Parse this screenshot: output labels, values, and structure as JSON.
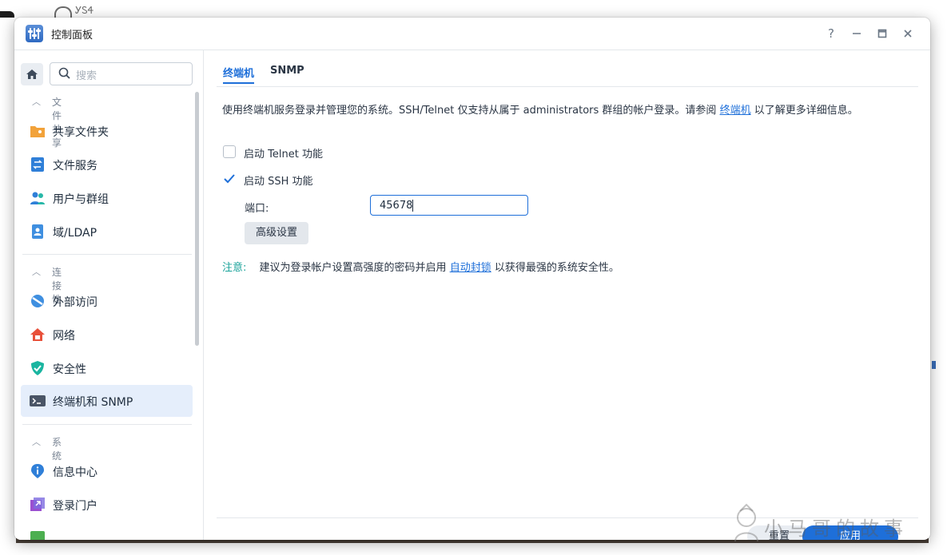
{
  "background": {
    "partial_title": "ᎩᏚᏎ"
  },
  "window": {
    "title": "控制面板",
    "help_glyph": "?",
    "minimize_glyph": "—",
    "maximize_glyph": "□",
    "close_glyph": "✕"
  },
  "sidebar": {
    "search_placeholder": "搜索",
    "sections": [
      {
        "label": "文件共享",
        "items": [
          {
            "label": "共享文件夹",
            "icon": "shared-folder-icon"
          },
          {
            "label": "文件服务",
            "icon": "file-services-icon"
          },
          {
            "label": "用户与群组",
            "icon": "users-groups-icon"
          },
          {
            "label": "域/LDAP",
            "icon": "domain-ldap-icon"
          }
        ]
      },
      {
        "label": "连接性",
        "items": [
          {
            "label": "外部访问",
            "icon": "external-access-icon"
          },
          {
            "label": "网络",
            "icon": "network-icon"
          },
          {
            "label": "安全性",
            "icon": "security-shield-icon"
          },
          {
            "label": "终端机和 SNMP",
            "icon": "terminal-icon",
            "active": true
          }
        ]
      },
      {
        "label": "系统",
        "items": [
          {
            "label": "信息中心",
            "icon": "info-center-icon"
          },
          {
            "label": "登录门户",
            "icon": "login-portal-icon"
          }
        ]
      }
    ]
  },
  "main": {
    "tabs": [
      {
        "label": "终端机",
        "active": true
      },
      {
        "label": "SNMP",
        "active": false
      }
    ],
    "description_prefix": "使用终端机服务登录并管理您的系统。SSH/Telnet 仅支持从属于 administrators 群组的帐户登录。请参阅",
    "description_link": "终端机",
    "description_suffix": "以了解更多详细信息。",
    "telnet": {
      "label": "启动 Telnet 功能",
      "checked": false
    },
    "ssh": {
      "label": "启动 SSH 功能",
      "checked": true
    },
    "port_label": "端口:",
    "port_value": "45678",
    "advanced_button": "高级设置",
    "note_label": "注意:",
    "note_prefix": "建议为登录帐户设置高强度的密码并启用",
    "note_link": "自动封锁",
    "note_suffix": "以获得最强的系统安全性。",
    "reset_button": "重置",
    "apply_button": "应用"
  },
  "watermark": {
    "text": "小马哥的故事"
  },
  "colors": {
    "accent": "#1e6fd9",
    "note": "#1aa39a",
    "active_bg": "#e5eefb"
  }
}
